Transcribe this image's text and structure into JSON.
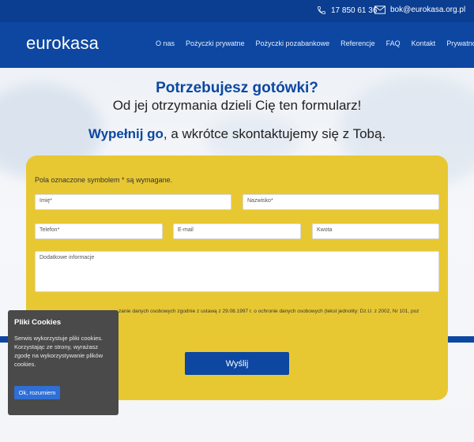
{
  "topbar": {
    "phone_icon": "phone-icon",
    "phone": "17 850 61 36",
    "mail_icon": "envelope-icon",
    "email": "bok@eurokasa.org.pl"
  },
  "brand": {
    "logo": "eurokasa"
  },
  "nav": {
    "items": [
      "O nas",
      "Pożyczki prywatne",
      "Pożyczki pozabankowe",
      "Referencje",
      "FAQ",
      "Kontakt",
      "Prywatność"
    ]
  },
  "hero": {
    "headline": "Potrzebujesz gotówki?",
    "subheadline": "Od jej otrzymania dzieli Cię ten formularz!",
    "cta_bold": "Wypełnij go",
    "cta_rest": ", a wkrótce skontaktujemy się z Tobą."
  },
  "form": {
    "required_note": "Pola oznaczone symbolem * są wymagane.",
    "fields": {
      "imie": "Imię*",
      "nazwisko": "Nazwisko*",
      "telefon": "Telefon*",
      "email": "E-mail",
      "kwota": "Kwota",
      "info": "Dodatkowe informacje"
    },
    "consent": "zanie danych osobowych zgodnie z ustawą z 29.08.1997 r. o ochronie danych osobowych (tekst jednolity: Dz.U. z 2002, Nr 101, poz",
    "submit": "Wyślij"
  },
  "cookie": {
    "title": "Pliki Cookies",
    "text": "Serwis wykorzystuje pliki cookies. Korzystając ze strony, wyrażasz zgodę na wykorzystywanie plików cookies.",
    "button": "Ok, rozumiem"
  },
  "colors": {
    "primary": "#0d47a1",
    "topbar": "#0b3d91",
    "form_bg": "#e8c832",
    "cookie_bg": "#4a4a4a",
    "cookie_button": "#2f6fd6"
  }
}
